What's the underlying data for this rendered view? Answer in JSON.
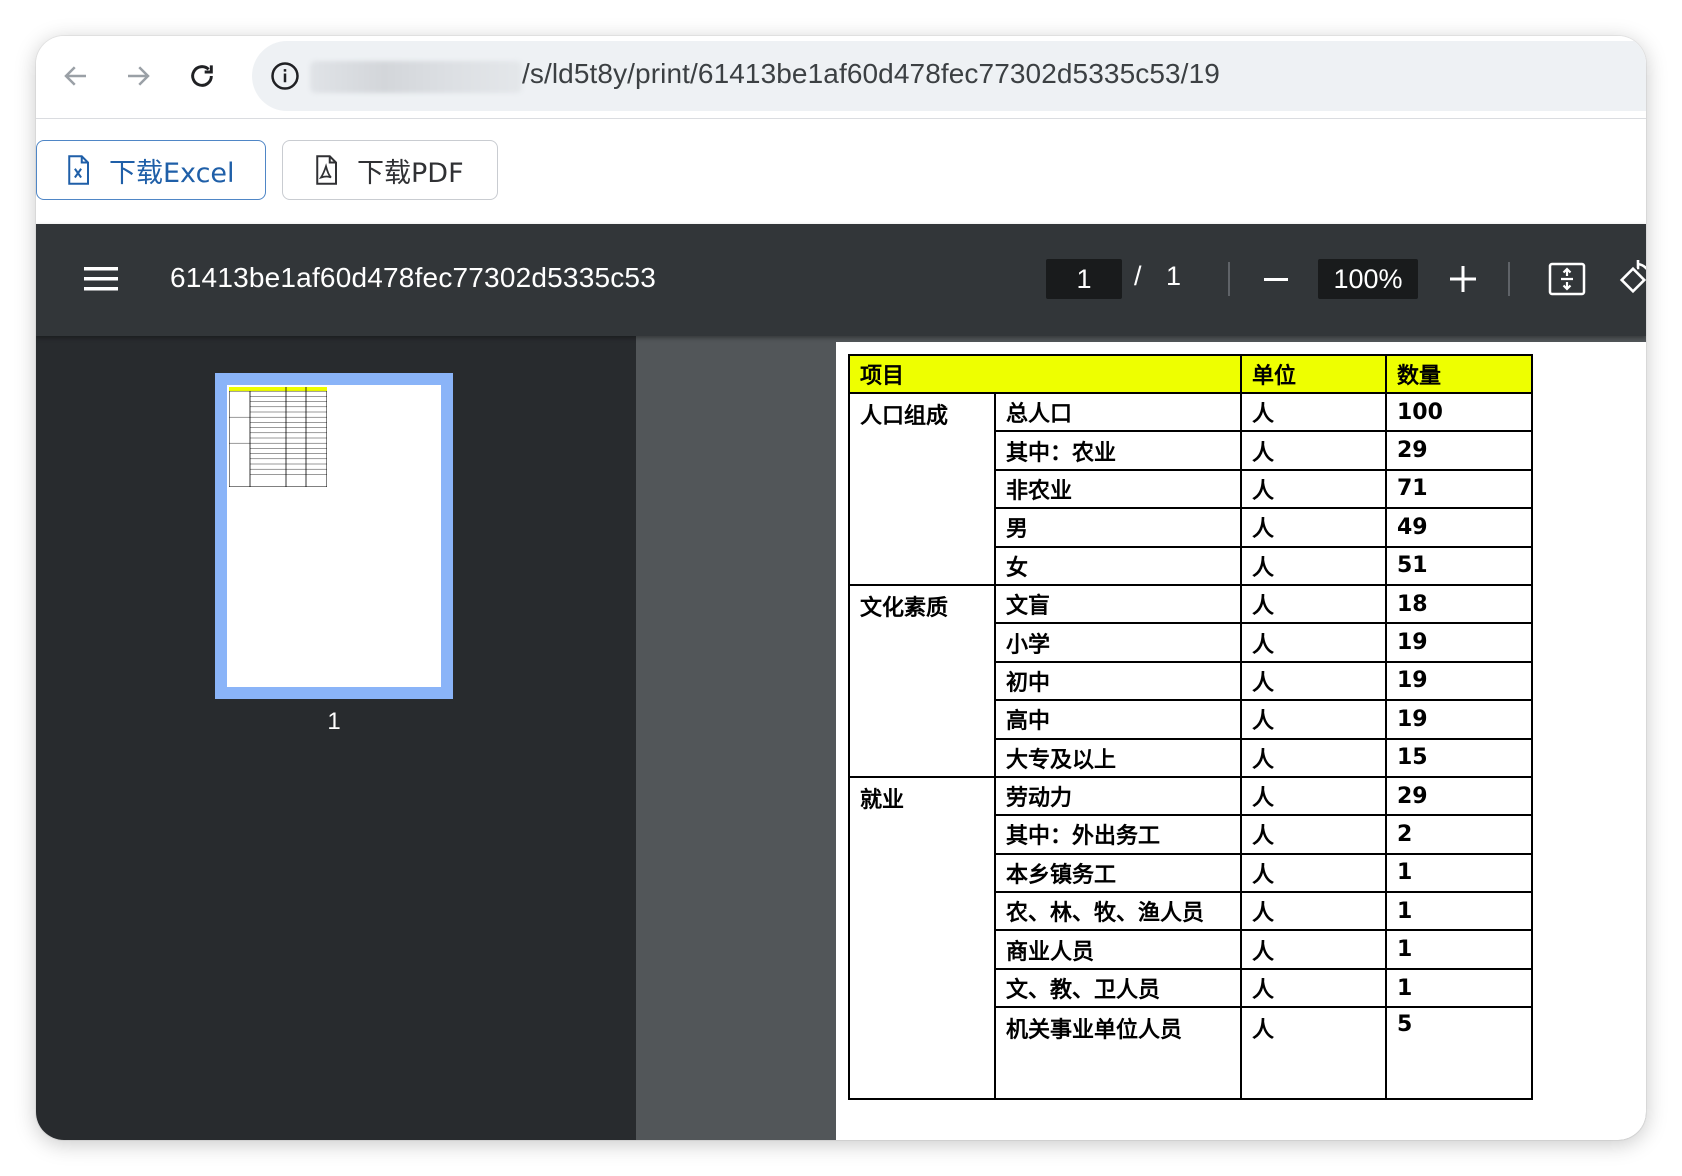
{
  "browser": {
    "url_visible": "/s/ld5t8y/print/61413be1af60d478fec77302d5335c53/19"
  },
  "downloads": {
    "excel_label": "下载Excel",
    "pdf_label": "下载PDF"
  },
  "viewer": {
    "doc_title": "61413be1af60d478fec77302d5335c53",
    "current_page": "1",
    "page_separator": "/",
    "total_pages": "1",
    "zoom": "100%",
    "thumbnail_label": "1",
    "colors": {
      "toolbar": "#323639",
      "sidebar": "#282b2e",
      "canvas": "#525659",
      "thumb_highlight": "#8ab4f8",
      "header_fill": "#eeff00"
    }
  },
  "table": {
    "headers": [
      "项目",
      "单位",
      "数量"
    ],
    "groups": [
      {
        "category": "人口组成",
        "rows": [
          {
            "item": "总人口",
            "unit": "人",
            "qty": "100"
          },
          {
            "item": "其中：农业",
            "unit": "人",
            "qty": "29"
          },
          {
            "item": "非农业",
            "unit": "人",
            "qty": "71"
          },
          {
            "item": "男",
            "unit": "人",
            "qty": "49"
          },
          {
            "item": "女",
            "unit": "人",
            "qty": "51"
          }
        ]
      },
      {
        "category": "文化素质",
        "rows": [
          {
            "item": "文盲",
            "unit": "人",
            "qty": "18"
          },
          {
            "item": "小学",
            "unit": "人",
            "qty": "19"
          },
          {
            "item": "初中",
            "unit": "人",
            "qty": "19"
          },
          {
            "item": "高中",
            "unit": "人",
            "qty": "19"
          },
          {
            "item": "大专及以上",
            "unit": "人",
            "qty": "15"
          }
        ]
      },
      {
        "category": "就业",
        "rows": [
          {
            "item": "劳动力",
            "unit": "人",
            "qty": "29"
          },
          {
            "item": "其中：外出务工",
            "unit": "人",
            "qty": "2"
          },
          {
            "item": "本乡镇务工",
            "unit": "人",
            "qty": "1"
          },
          {
            "item": "农、林、牧、渔人员",
            "unit": "人",
            "qty": "1"
          },
          {
            "item": "商业人员",
            "unit": "人",
            "qty": "1"
          },
          {
            "item": "文、教、卫人员",
            "unit": "人",
            "qty": "1"
          },
          {
            "item": "机关事业单位人员",
            "unit": "人",
            "qty": "5"
          }
        ]
      }
    ]
  }
}
